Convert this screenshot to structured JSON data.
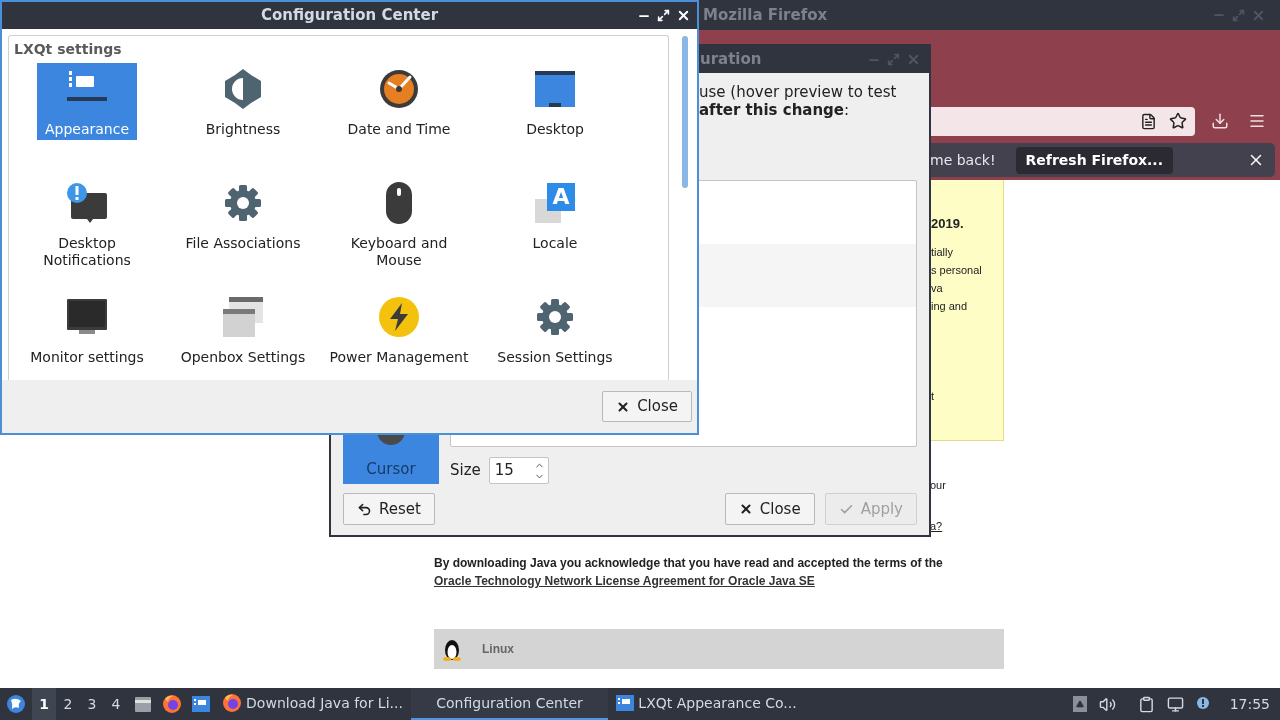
{
  "firefox": {
    "title": "Mozilla Firefox",
    "notification": {
      "message": "me back!",
      "button": "Refresh Firefox..."
    },
    "page": {
      "notice": {
        "heading": "2019.",
        "paragraphs": [
          [
            "tially",
            "s personal",
            "va",
            "ing and"
          ],
          [
            "t"
          ]
        ]
      },
      "fragments": [
        {
          "kind": "text",
          "text": "our"
        },
        {
          "kind": "link",
          "text": "a?"
        }
      ],
      "license": {
        "text": "By downloading Java you acknowledge that you have read and accepted the terms of the",
        "link": "Oracle Technology Network License Agreement for Oracle Java SE"
      },
      "download_row": {
        "label": "Linux"
      }
    }
  },
  "appearance_window": {
    "title": "uration",
    "description": [
      "use (hover preview to test",
      "**after this change**:"
    ],
    "categories": [
      {
        "label": "Cursor",
        "selected": true
      }
    ],
    "size": {
      "label": "Size",
      "value": "15"
    },
    "buttons": [
      {
        "kind": "reset",
        "label": "Reset",
        "disabled": false
      },
      {
        "kind": "close",
        "label": "Close",
        "disabled": false
      },
      {
        "kind": "apply",
        "label": "Apply",
        "disabled": true
      }
    ]
  },
  "config_center": {
    "title": "Configuration Center",
    "group": "LXQt settings",
    "items": [
      {
        "label": "Appearance",
        "kind": "appearance",
        "selected": true
      },
      {
        "label": "Brightness",
        "kind": "brightness",
        "selected": false
      },
      {
        "label": "Date and Time",
        "kind": "clock",
        "selected": false
      },
      {
        "label": "Desktop",
        "kind": "desktop",
        "selected": false
      },
      {
        "label": "Desktop Notifications",
        "kind": "notifications",
        "selected": false
      },
      {
        "label": "File Associations",
        "kind": "gear",
        "selected": false
      },
      {
        "label": "Keyboard and Mouse",
        "kind": "mouse",
        "selected": false
      },
      {
        "label": "Locale",
        "kind": "locale",
        "badge": "A",
        "selected": false
      },
      {
        "label": "Monitor settings",
        "kind": "monitor",
        "selected": false
      },
      {
        "label": "Openbox Settings",
        "kind": "windows",
        "selected": false
      },
      {
        "label": "Power Management",
        "kind": "power",
        "selected": false
      },
      {
        "label": "Session Settings",
        "kind": "gear",
        "selected": false
      }
    ],
    "close_button": "Close"
  },
  "taskbar": {
    "desktops": [
      {
        "label": "1",
        "selected": true
      },
      {
        "label": "2",
        "selected": false
      },
      {
        "label": "3",
        "selected": false
      },
      {
        "label": "4",
        "selected": false
      }
    ],
    "tasks": [
      {
        "label": "Download Java for Li...",
        "kind": "browser",
        "selected": false
      },
      {
        "label": "Configuration Center",
        "kind": "none",
        "selected": true
      },
      {
        "label": "LXQt Appearance Co...",
        "kind": "app",
        "selected": false
      }
    ],
    "clock": "17:55"
  }
}
